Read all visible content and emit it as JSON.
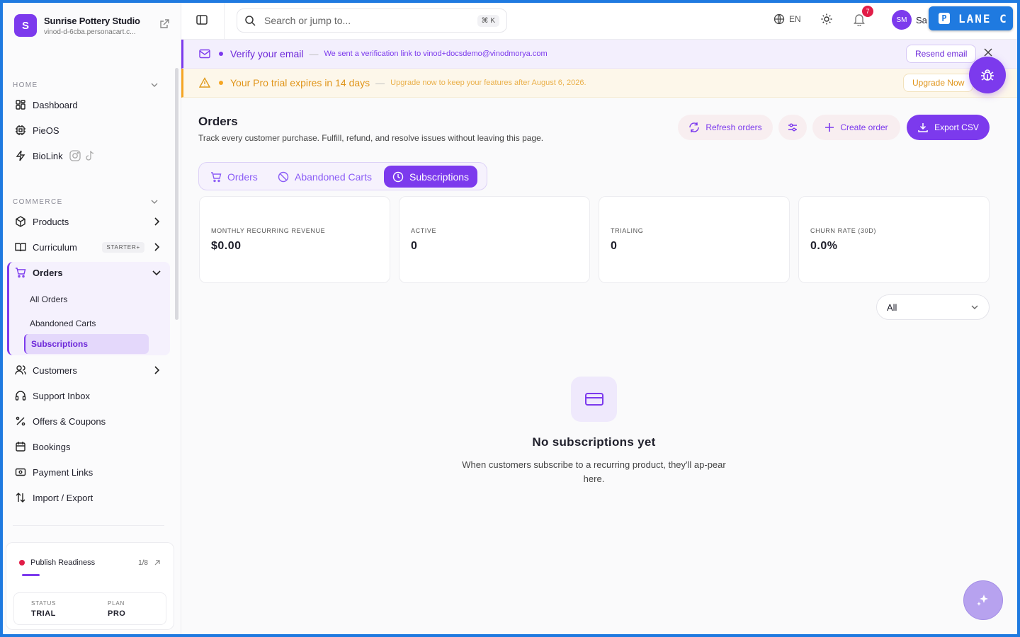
{
  "brand": {
    "initial": "S",
    "name": "Sunrise Pottery Studio",
    "url": "vinod-d-6cba.personacart.c..."
  },
  "sidebar": {
    "home_label": "HOME",
    "home_items": [
      {
        "label": "Dashboard",
        "icon": "grid-icon"
      },
      {
        "label": "PieOS",
        "icon": "chip-icon"
      },
      {
        "label": "BioLink",
        "icon": "bolt-icon"
      }
    ],
    "commerce_label": "COMMERCE",
    "products": "Products",
    "curriculum": "Curriculum",
    "curriculum_badge": "STARTER+",
    "orders": "Orders",
    "orders_sub": [
      "All Orders",
      "Abandoned Carts",
      "Subscriptions"
    ],
    "customers": "Customers",
    "support": "Support Inbox",
    "offers": "Offers & Coupons",
    "bookings": "Bookings",
    "payment_links": "Payment Links",
    "import_export": "Import / Export",
    "publish": {
      "label": "Publish Readiness",
      "count": "1/8",
      "progress": 0.125,
      "status_key": "STATUS",
      "status_val": "TRIAL",
      "plan_key": "PLAN",
      "plan_val": "PRO"
    }
  },
  "topbar": {
    "search_placeholder": "Search or jump to...",
    "shortcut": "⌘ K",
    "lang": "EN",
    "notifications": "7",
    "avatar": "SM",
    "user_name": "Sa",
    "lane": "LANE C",
    "lane_letter": "P"
  },
  "banners": {
    "verify_title": "Verify your email",
    "verify_sub": "We sent a verification link to vinod+docsdemo@vinodmorya.com",
    "verify_btn": "Resend email",
    "trial_title": "Your Pro trial expires in 14 days",
    "trial_sub": "Upgrade now to keep your features after August 6, 2026.",
    "trial_btn": "Upgrade Now",
    "sep": "—"
  },
  "main": {
    "title": "Orders",
    "subtitle": "Track every customer purchase. Fulfill, refund, and resolve issues without leaving this page.",
    "refresh": "Refresh orders",
    "create": "Create order",
    "export": "Export CSV",
    "tabs": [
      "Orders",
      "Abandoned Carts",
      "Subscriptions"
    ],
    "cards": [
      {
        "label": "MONTHLY RECURRING REVENUE",
        "value": "$0.00"
      },
      {
        "label": "ACTIVE",
        "value": "0"
      },
      {
        "label": "TRIALING",
        "value": "0"
      },
      {
        "label": "CHURN RATE (30D)",
        "value": "0.0%"
      }
    ],
    "filter": "All",
    "empty_title": "No subscriptions yet",
    "empty_sub": "When customers subscribe to a recurring product, they'll ap-pear here."
  },
  "colors": {
    "accent": "#7c3aed",
    "lane": "#1f7ae0",
    "warning": "#f5a623",
    "alert": "#e11d48"
  }
}
